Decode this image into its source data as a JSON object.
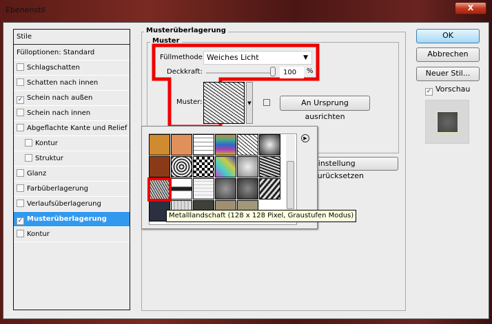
{
  "window": {
    "title": "Ebenenstil",
    "close_label": "X"
  },
  "styles": {
    "header": "Stile",
    "blend": "Fülloptionen: Standard",
    "items": [
      {
        "label": "Schlagschatten",
        "checked": false
      },
      {
        "label": "Schatten nach innen",
        "checked": false
      },
      {
        "label": "Schein nach außen",
        "checked": true
      },
      {
        "label": "Schein nach innen",
        "checked": false
      },
      {
        "label": "Abgeflachte Kante und Relief",
        "checked": false
      },
      {
        "label": "Kontur",
        "checked": false,
        "sub": true
      },
      {
        "label": "Struktur",
        "checked": false,
        "sub": true
      },
      {
        "label": "Glanz",
        "checked": false
      },
      {
        "label": "Farbüberlagerung",
        "checked": false
      },
      {
        "label": "Verlaufsüberlagerung",
        "checked": false
      },
      {
        "label": "Musterüberlagerung",
        "checked": true,
        "selected": true
      },
      {
        "label": "Kontur",
        "checked": false
      }
    ]
  },
  "main": {
    "group_title": "Musterüberlagerung",
    "sub_title": "Muster",
    "fill_label": "Füllmethode:",
    "fill_value": "Weiches Licht",
    "opacity_label": "Deckkraft:",
    "opacity_value": "100",
    "opacity_unit": "%",
    "pattern_label": "Muster:",
    "align_button": "An Ursprung ausrichten",
    "reset_button": "einstellung zurücksetzen",
    "tooltip": "Metalllandschaft (128 x 128 Pixel, Graustufen Modus)"
  },
  "buttons": {
    "ok": "OK",
    "cancel": "Abbrechen",
    "new_style": "Neuer Stil...",
    "preview": "Vorschau",
    "preview_checked": true
  },
  "highlight_color": "#e00000",
  "pattern_tiles": [
    [
      "#d08a30",
      "#e0905a",
      "grid",
      "rainbow",
      "cracks",
      "stone"
    ],
    [
      "#8a3a18",
      "squares",
      "checker",
      "confetti",
      "clouds",
      "rough"
    ],
    [
      "metal",
      "dots",
      "bricks",
      "granite",
      "granite2",
      "camo"
    ],
    [
      "#2a3040",
      "wood",
      "#404038",
      "#a09070",
      "#a09878",
      ""
    ]
  ]
}
